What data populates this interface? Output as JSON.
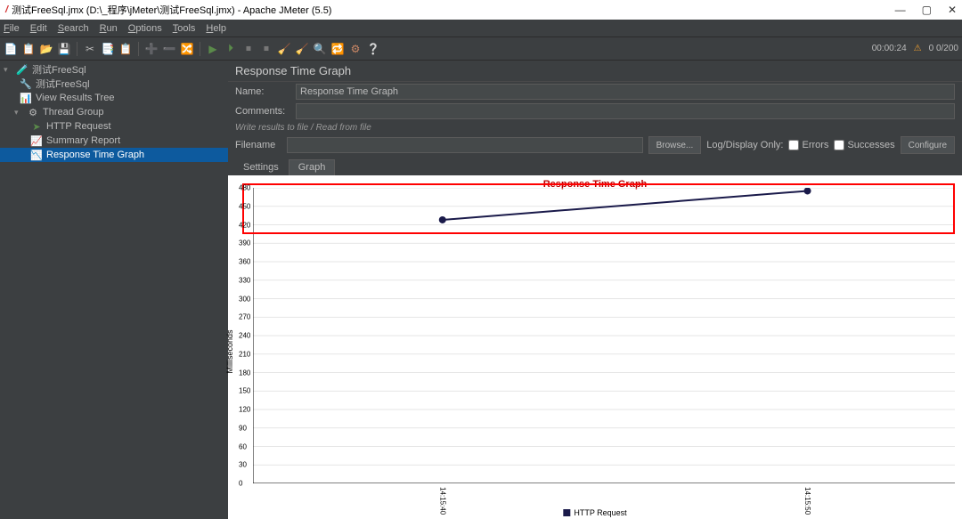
{
  "window": {
    "title": "测试FreeSql.jmx (D:\\_程序\\jMeter\\测试FreeSql.jmx) - Apache JMeter (5.5)",
    "minimize": "—",
    "maximize": "▢",
    "close": "✕"
  },
  "menu": {
    "file": "File",
    "edit": "Edit",
    "search": "Search",
    "run": "Run",
    "options": "Options",
    "tools": "Tools",
    "help": "Help"
  },
  "status": {
    "time": "00:00:24",
    "warn": "⚠",
    "counter": "0  0/200"
  },
  "tree": {
    "root": "测试FreeSql",
    "items": [
      "测试FreeSql",
      "View Results Tree",
      "Thread Group",
      "HTTP Request",
      "Summary Report",
      "Response Time Graph"
    ]
  },
  "panel": {
    "title": "Response Time Graph",
    "name_label": "Name:",
    "name_value": "Response Time Graph",
    "comments_label": "Comments:",
    "comments_value": "",
    "section": "Write results to file / Read from file",
    "filename_label": "Filename",
    "filename_value": "",
    "browse": "Browse...",
    "logdisplay": "Log/Display Only:",
    "errors": "Errors",
    "successes": "Successes",
    "configure": "Configure"
  },
  "tabs": {
    "settings": "Settings",
    "graph": "Graph"
  },
  "chart_data": {
    "type": "line",
    "title": "Response Time Graph",
    "ylabel": "Milliseconds",
    "xlabel": "",
    "ylim": [
      0,
      480
    ],
    "yticks": [
      0,
      30,
      60,
      90,
      120,
      150,
      180,
      210,
      240,
      270,
      300,
      330,
      360,
      390,
      420,
      450,
      480
    ],
    "categories": [
      "14:15:40",
      "14:15:50"
    ],
    "series": [
      {
        "name": "HTTP Request",
        "values": [
          428,
          475
        ]
      }
    ],
    "legend": "HTTP Request"
  }
}
